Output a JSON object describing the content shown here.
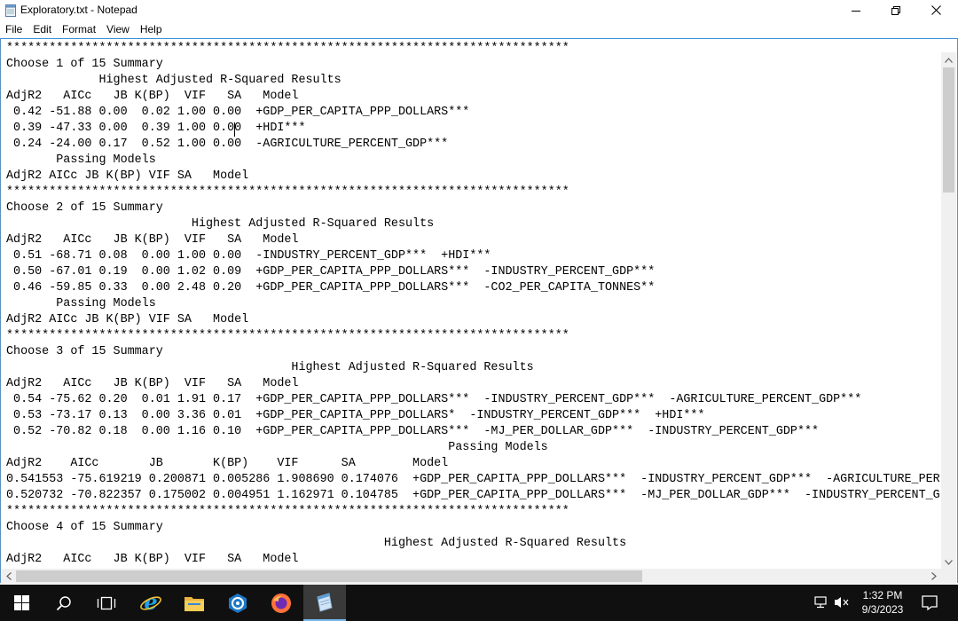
{
  "window": {
    "title": "Exploratory.txt - Notepad"
  },
  "menu": {
    "items": [
      "File",
      "Edit",
      "Format",
      "View",
      "Help"
    ]
  },
  "editor": {
    "lines": [
      "*******************************************************************************",
      "Choose 1 of 15 Summary",
      "             Highest Adjusted R-Squared Results",
      "AdjR2   AICc   JB K(BP)  VIF   SA   Model",
      " 0.42 -51.88 0.00  0.02 1.00 0.00  +GDP_PER_CAPITA_PPP_DOLLARS***",
      " 0.39 -47.33 0.00  0.39 1.00 0.00  +HDI***",
      " 0.24 -24.00 0.17  0.52 1.00 0.00  -AGRICULTURE_PERCENT_GDP***",
      "       Passing Models",
      "AdjR2 AICc JB K(BP) VIF SA   Model",
      "*******************************************************************************",
      "Choose 2 of 15 Summary",
      "                          Highest Adjusted R-Squared Results",
      "AdjR2   AICc   JB K(BP)  VIF   SA   Model",
      " 0.51 -68.71 0.08  0.00 1.00 0.00  -INDUSTRY_PERCENT_GDP***  +HDI***",
      " 0.50 -67.01 0.19  0.00 1.02 0.09  +GDP_PER_CAPITA_PPP_DOLLARS***  -INDUSTRY_PERCENT_GDP***",
      " 0.46 -59.85 0.33  0.00 2.48 0.20  +GDP_PER_CAPITA_PPP_DOLLARS***  -CO2_PER_CAPITA_TONNES**",
      "       Passing Models",
      "AdjR2 AICc JB K(BP) VIF SA   Model",
      "*******************************************************************************",
      "Choose 3 of 15 Summary",
      "                                        Highest Adjusted R-Squared Results",
      "AdjR2   AICc   JB K(BP)  VIF   SA   Model",
      " 0.54 -75.62 0.20  0.01 1.91 0.17  +GDP_PER_CAPITA_PPP_DOLLARS***  -INDUSTRY_PERCENT_GDP***  -AGRICULTURE_PERCENT_GDP***",
      " 0.53 -73.17 0.13  0.00 3.36 0.01  +GDP_PER_CAPITA_PPP_DOLLARS*  -INDUSTRY_PERCENT_GDP***  +HDI***",
      " 0.52 -70.82 0.18  0.00 1.16 0.10  +GDP_PER_CAPITA_PPP_DOLLARS***  -MJ_PER_DOLLAR_GDP***  -INDUSTRY_PERCENT_GDP***",
      "                                                              Passing Models",
      "AdjR2    AICc       JB       K(BP)    VIF      SA        Model",
      "0.541553 -75.619219 0.200871 0.005286 1.908690 0.174076  +GDP_PER_CAPITA_PPP_DOLLARS***  -INDUSTRY_PERCENT_GDP***  -AGRICULTURE_PERC",
      "0.520732 -70.822357 0.175002 0.004951 1.162971 0.104785  +GDP_PER_CAPITA_PPP_DOLLARS***  -MJ_PER_DOLLAR_GDP***  -INDUSTRY_PERCENT_GI",
      "*******************************************************************************",
      "Choose 4 of 15 Summary",
      "                                                     Highest Adjusted R-Squared Results",
      "AdjR2   AICc   JB K(BP)  VIF   SA   Model"
    ]
  },
  "taskbar": {
    "apps": [
      {
        "name": "start-icon"
      },
      {
        "name": "search-icon"
      },
      {
        "name": "task-view-icon"
      },
      {
        "name": "internet-explorer-icon"
      },
      {
        "name": "file-explorer-icon"
      },
      {
        "name": "arcgis-icon"
      },
      {
        "name": "firefox-icon"
      },
      {
        "name": "notepad-icon"
      }
    ],
    "clock": {
      "time": "1:32 PM",
      "date": "9/3/2023"
    }
  },
  "colors": {
    "taskbar": "#101010",
    "active_app_indicator": "#76b9ed",
    "window_border": "#3c8fd6"
  }
}
